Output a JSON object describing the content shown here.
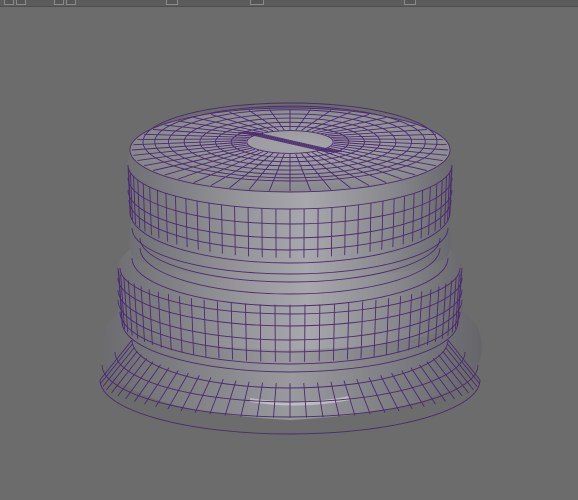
{
  "app": {
    "viewport_background": "#6c6c6c",
    "mesh_fill": "#8e8e92",
    "wire_color": "#4a2a70",
    "highlight_color": "#cfcfd3"
  },
  "toolbar": {
    "icons": [
      {
        "name": "select-tool-icon",
        "active": false
      },
      {
        "name": "move-tool-icon",
        "active": false
      },
      {
        "name": "rotate-tool-icon",
        "active": false
      },
      {
        "name": "view-mode-icon",
        "active": true
      },
      {
        "name": "camera-icon",
        "active": false
      },
      {
        "name": "display-icon",
        "active": false
      },
      {
        "name": "panel-layout-icon",
        "active": true
      }
    ]
  }
}
